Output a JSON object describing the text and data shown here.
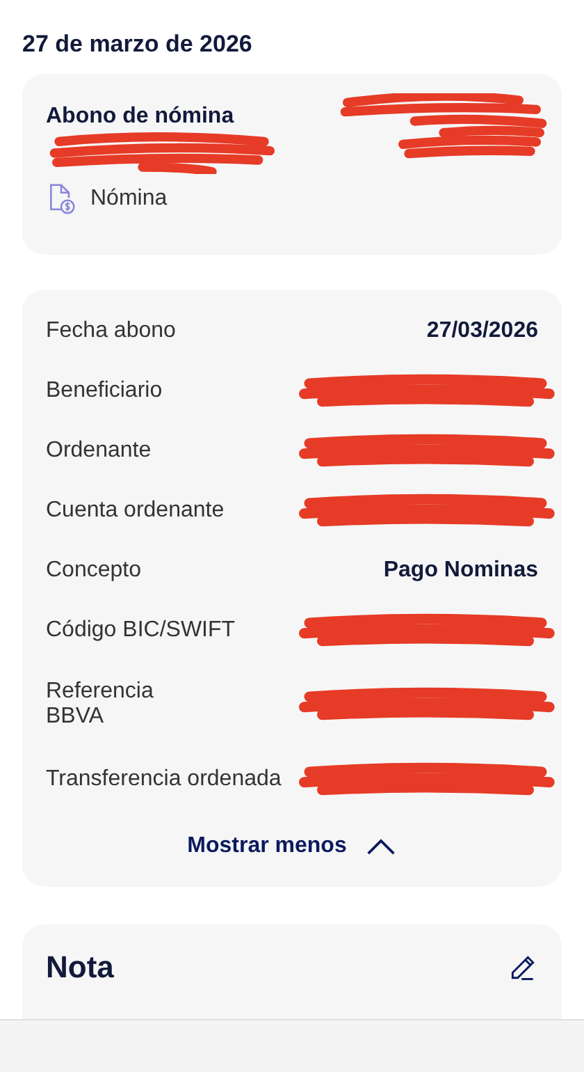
{
  "date_heading": "27 de marzo de 2026",
  "summary": {
    "title": "Abono de nómina",
    "category": "Nómina",
    "redacted": true
  },
  "details": [
    {
      "label": "Fecha abono",
      "kind": "text",
      "value": "27/03/2026"
    },
    {
      "label": "Beneficiario",
      "kind": "redacted"
    },
    {
      "label": "Ordenante",
      "kind": "redacted"
    },
    {
      "label": "Cuenta ordenante",
      "kind": "redacted"
    },
    {
      "label": "Concepto",
      "kind": "text",
      "value": "Pago Nominas"
    },
    {
      "label": "Código BIC/SWIFT",
      "kind": "redacted"
    },
    {
      "label": "Referencia BBVA",
      "kind": "redacted"
    },
    {
      "label": "Transferencia ordenada",
      "kind": "redacted"
    }
  ],
  "toggle": {
    "label": "Mostrar menos",
    "expanded": true
  },
  "note": {
    "title": "Nota"
  }
}
